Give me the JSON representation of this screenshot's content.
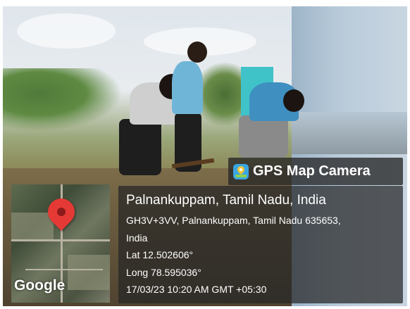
{
  "stamp": {
    "app_name": "GPS Map Camera",
    "place": "Palnankuppam, Tamil Nadu, India",
    "address_line1": "GH3V+3VV, Palnankuppam, Tamil Nadu 635653,",
    "address_line2": "India",
    "latitude": "Lat 12.502606°",
    "longitude": "Long 78.595036°",
    "datetime": "17/03/23 10:20 AM GMT +05:30"
  },
  "map": {
    "logo": "Google",
    "pin_color": "#e53935"
  },
  "colors": {
    "overlay": "#262626",
    "text": "#ffffff"
  }
}
